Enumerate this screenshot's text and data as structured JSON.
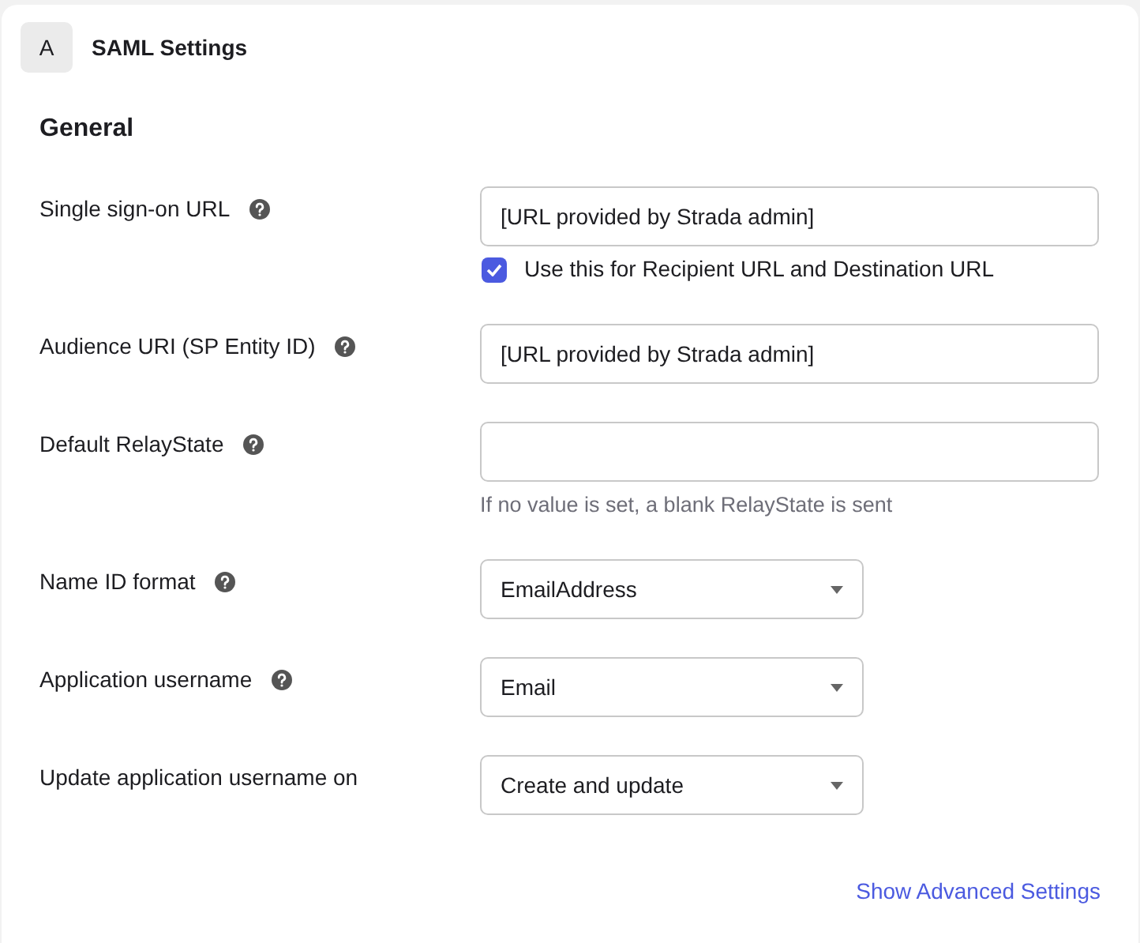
{
  "header": {
    "badge": "A",
    "title": "SAML Settings"
  },
  "section": {
    "title": "General"
  },
  "fields": [
    {
      "kind": "text",
      "label": "Single sign-on URL",
      "help": true,
      "value": "[URL provided by Strada admin]",
      "checkbox": {
        "label": "Use this for Recipient URL and Destination URL",
        "checked": true
      }
    },
    {
      "kind": "text",
      "label": "Audience URI (SP Entity ID)",
      "help": true,
      "value": "[URL provided by Strada admin]"
    },
    {
      "kind": "text",
      "label": "Default RelayState",
      "help": true,
      "hint": "If no value is set, a blank RelayState is sent"
    },
    {
      "kind": "select",
      "label": "Name ID format",
      "help": true,
      "value": "EmailAddress"
    },
    {
      "kind": "select",
      "label": "Application username",
      "help": true,
      "value": "Email"
    },
    {
      "kind": "select",
      "label": "Update application username on",
      "help": false,
      "value": "Create and update"
    }
  ],
  "link": "Show Advanced Settings"
}
